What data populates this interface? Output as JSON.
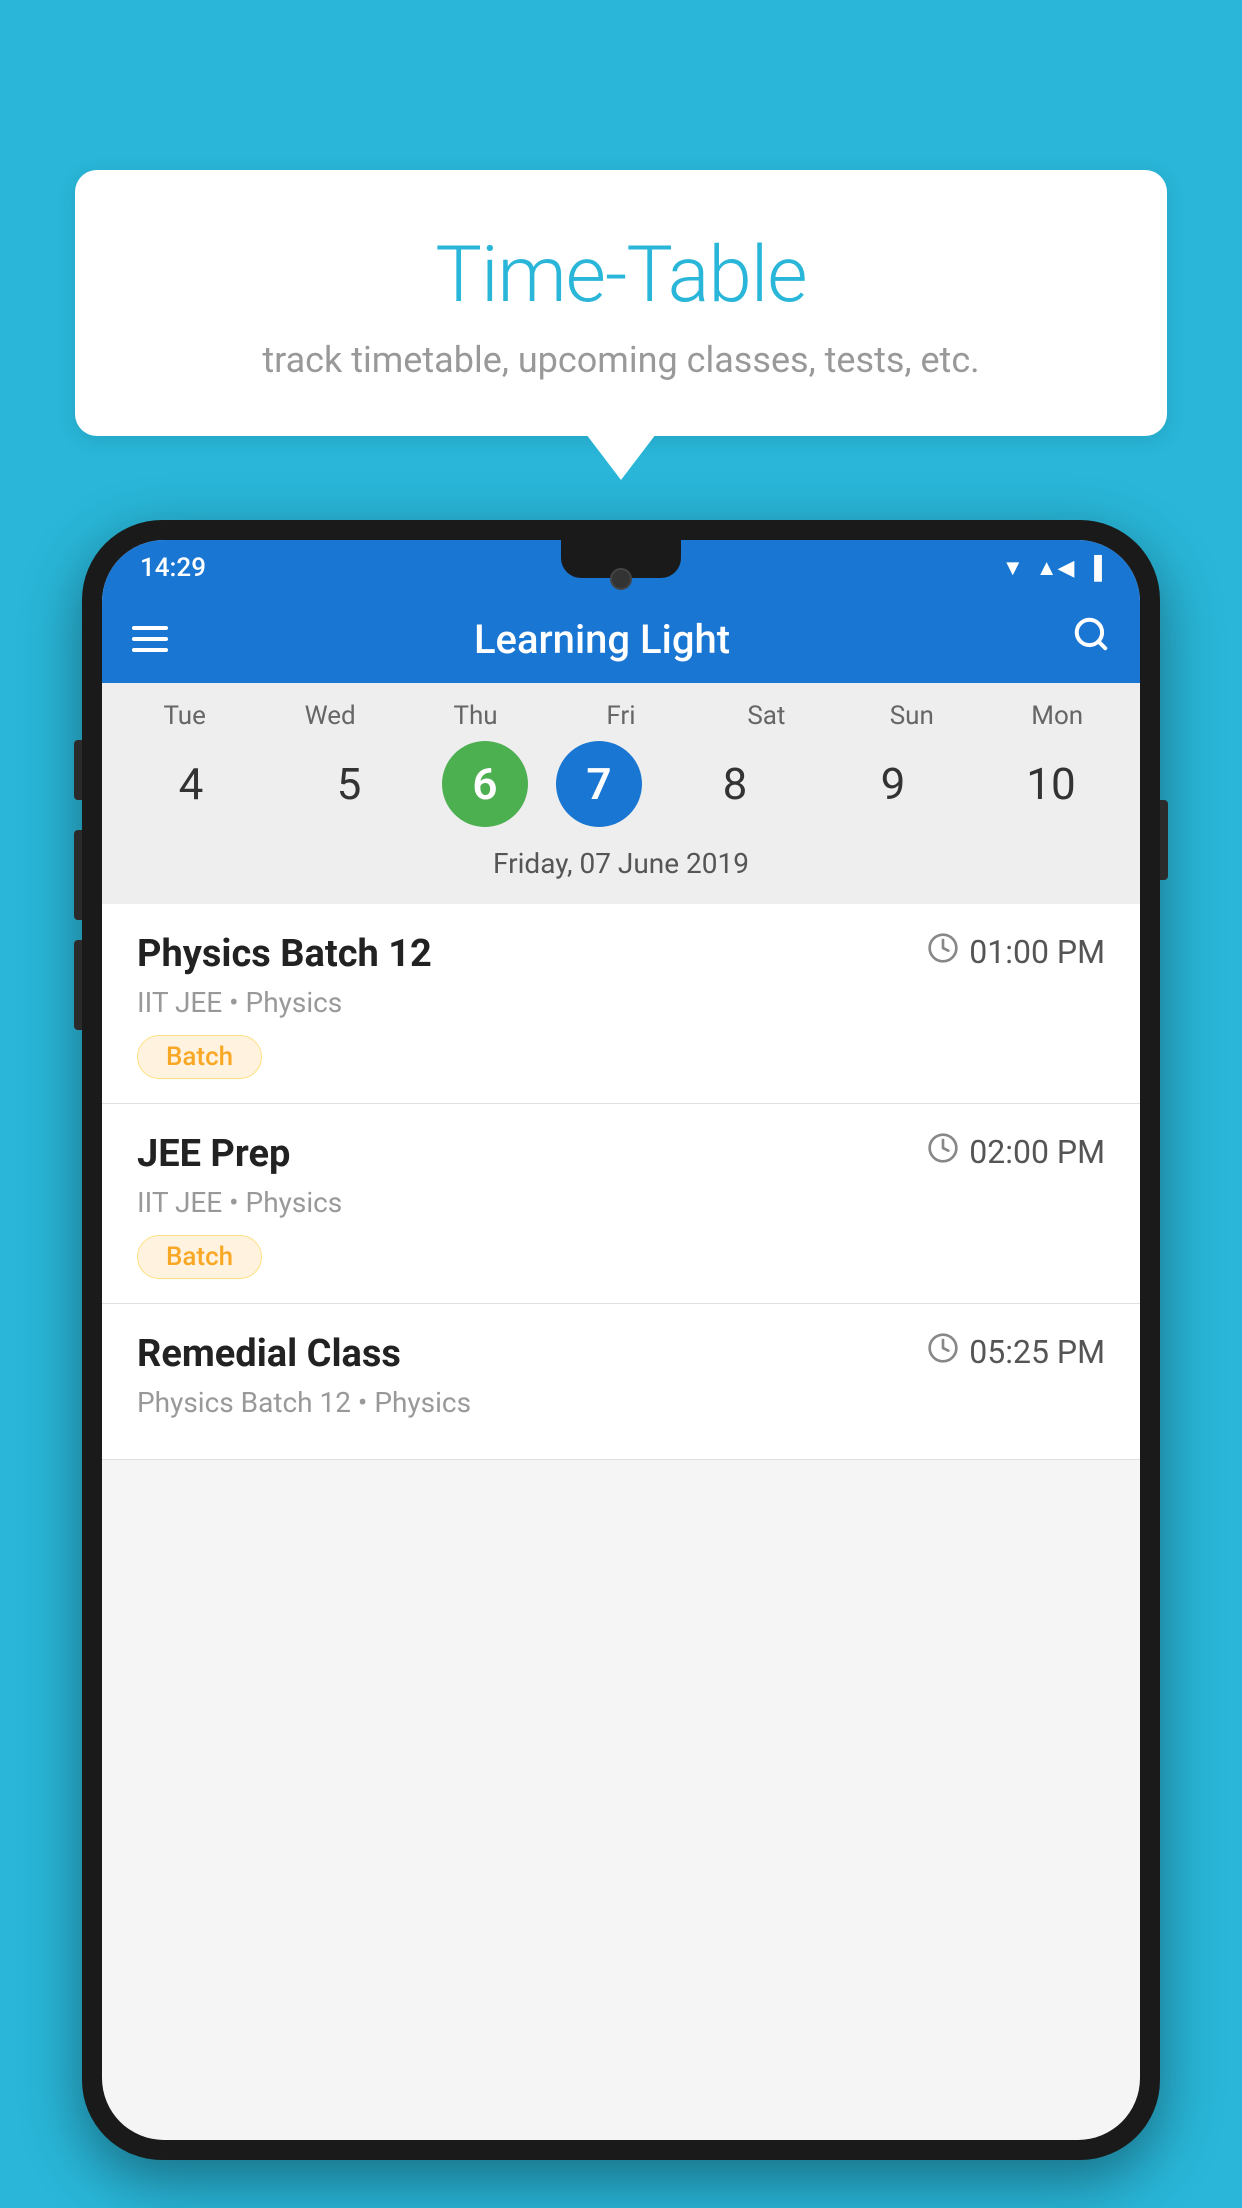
{
  "background_color": "#29B6D8",
  "bubble": {
    "title": "Time-Table",
    "subtitle": "track timetable, upcoming classes, tests, etc."
  },
  "status_bar": {
    "time": "14:29"
  },
  "app_bar": {
    "title": "Learning Light"
  },
  "calendar": {
    "days": [
      {
        "abbr": "Tue",
        "num": "4",
        "state": "normal"
      },
      {
        "abbr": "Wed",
        "num": "5",
        "state": "normal"
      },
      {
        "abbr": "Thu",
        "num": "6",
        "state": "today"
      },
      {
        "abbr": "Fri",
        "num": "7",
        "state": "selected"
      },
      {
        "abbr": "Sat",
        "num": "8",
        "state": "normal"
      },
      {
        "abbr": "Sun",
        "num": "9",
        "state": "normal"
      },
      {
        "abbr": "Mon",
        "num": "10",
        "state": "normal"
      }
    ],
    "selected_date": "Friday, 07 June 2019"
  },
  "classes": [
    {
      "name": "Physics Batch 12",
      "time": "01:00 PM",
      "subject": "IIT JEE • Physics",
      "badge": "Batch"
    },
    {
      "name": "JEE Prep",
      "time": "02:00 PM",
      "subject": "IIT JEE • Physics",
      "badge": "Batch"
    },
    {
      "name": "Remedial Class",
      "time": "05:25 PM",
      "subject": "Physics Batch 12 • Physics",
      "badge": ""
    }
  ],
  "icons": {
    "hamburger": "≡",
    "search": "🔍",
    "clock": "🕐"
  }
}
